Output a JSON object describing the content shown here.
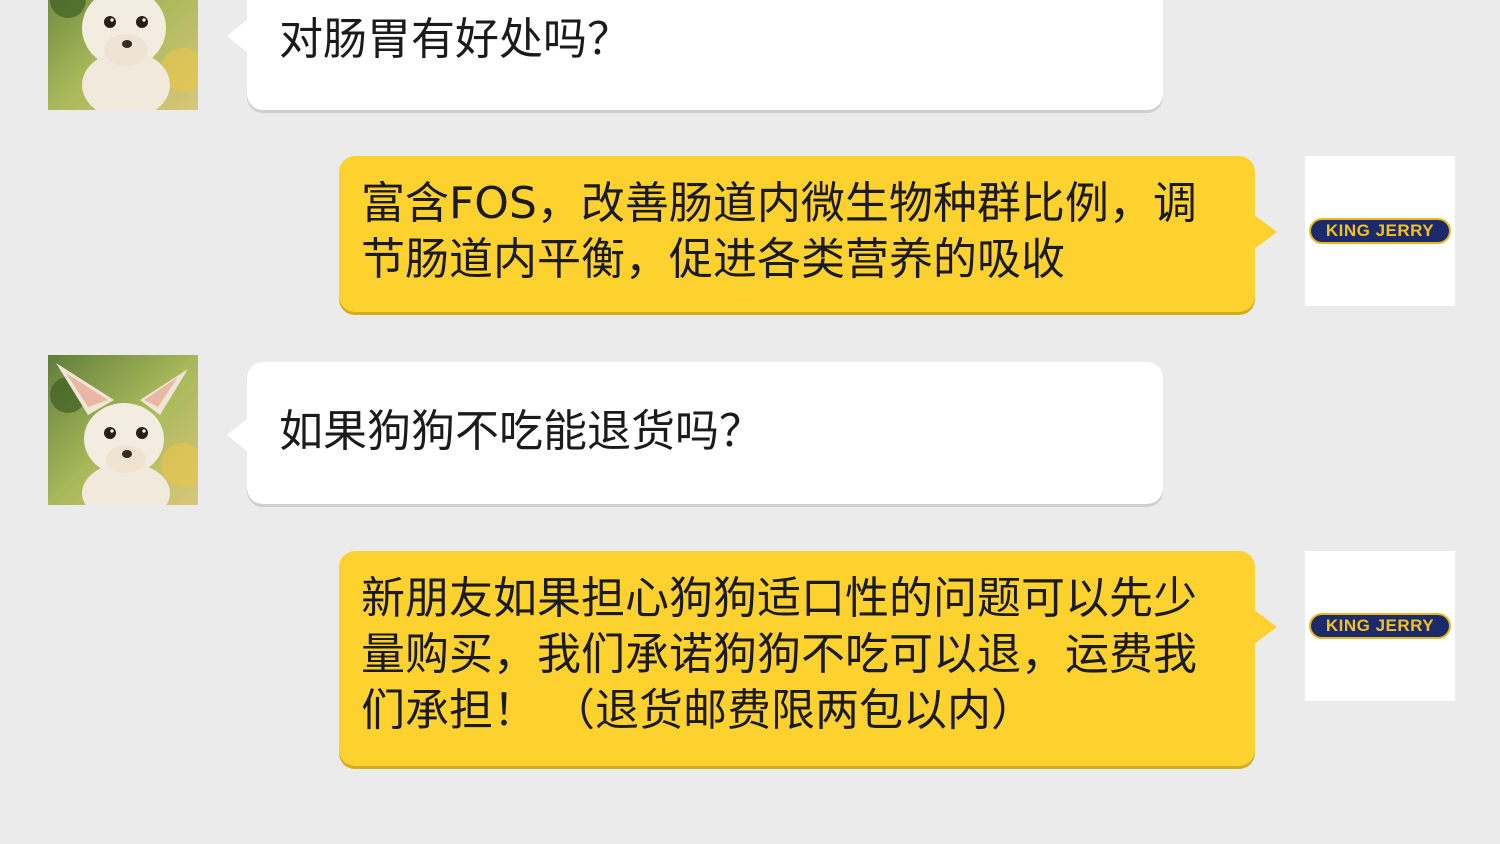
{
  "conversation": {
    "messages": [
      {
        "sender": "customer",
        "avatar_icon": "chihuahua-avatar",
        "text": "对肠胃有好处吗？"
      },
      {
        "sender": "brand",
        "avatar_icon": "king-jerry-logo",
        "text": "富含FOS，改善肠道内微生物种群比例，调节肠道内平衡，促进各类营养的吸收"
      },
      {
        "sender": "customer",
        "avatar_icon": "chihuahua-avatar",
        "text": "如果狗狗不吃能退货吗？"
      },
      {
        "sender": "brand",
        "avatar_icon": "king-jerry-logo",
        "text": "新朋友如果担心狗狗适口性的问题可以先少量购买，我们承诺狗狗不吃可以退，运费我们承担！ （退货邮费限两包以内）"
      }
    ]
  },
  "brand": {
    "logo_text": "KING JERRY"
  },
  "colors": {
    "background": "#ebebec",
    "incoming_bubble": "#ffffff",
    "outgoing_bubble": "#fdd22f",
    "logo_navy": "#1c2a6b",
    "logo_gold": "#e7b91c"
  }
}
